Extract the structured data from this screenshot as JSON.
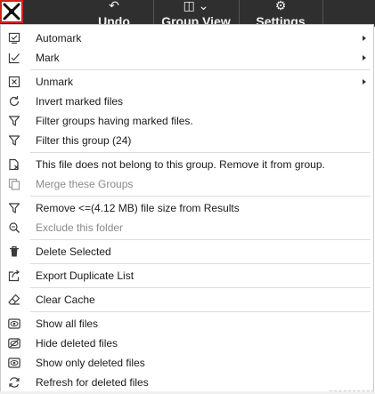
{
  "toolbar": {
    "undo_label": "Undo",
    "group_view_label": "Group View",
    "settings_label": "Settings"
  },
  "menu": {
    "items": [
      {
        "label": "Automark",
        "icon": "checkbox-icon",
        "submenu": true,
        "disabled": false
      },
      {
        "label": "Mark",
        "icon": "checkmark-box-icon",
        "submenu": true,
        "disabled": false
      },
      {
        "label": "Unmark",
        "icon": "x-box-icon",
        "submenu": true,
        "disabled": false
      },
      {
        "label": "Invert marked files",
        "icon": "refresh-icon",
        "submenu": false,
        "disabled": false
      },
      {
        "label": "Filter groups having marked files.",
        "icon": "filter-icon",
        "submenu": false,
        "disabled": false
      },
      {
        "label": "Filter this group (24)",
        "icon": "filter-icon",
        "submenu": false,
        "disabled": false
      },
      {
        "label": "This file does not belong to this group. Remove it from group.",
        "icon": "file-remove-icon",
        "submenu": false,
        "disabled": false
      },
      {
        "label": "Merge these Groups",
        "icon": "merge-icon",
        "submenu": false,
        "disabled": true
      },
      {
        "label": "Remove <=(4.12 MB) file size from Results",
        "icon": "filter-icon",
        "submenu": false,
        "disabled": false
      },
      {
        "label": "Exclude this folder",
        "icon": "search-icon",
        "submenu": false,
        "disabled": true
      },
      {
        "label": "Delete Selected",
        "icon": "trash-icon",
        "submenu": false,
        "disabled": false
      },
      {
        "label": "Export Duplicate List",
        "icon": "export-icon",
        "submenu": false,
        "disabled": false
      },
      {
        "label": "Clear Cache",
        "icon": "eraser-icon",
        "submenu": false,
        "disabled": false
      },
      {
        "label": "Show all files",
        "icon": "eye-icon",
        "submenu": false,
        "disabled": false
      },
      {
        "label": "Hide deleted files",
        "icon": "eye-off-icon",
        "submenu": false,
        "disabled": false
      },
      {
        "label": "Show only deleted files",
        "icon": "eye-icon",
        "submenu": false,
        "disabled": false
      },
      {
        "label": "Refresh for deleted files",
        "icon": "refresh-icon",
        "submenu": false,
        "disabled": false
      }
    ]
  },
  "colors": {
    "toolbar_bg": "#2f2f2f",
    "menu_bg": "#ffffff",
    "disabled_text": "#8a8a8a",
    "app_icon_border": "#d61f1f"
  }
}
